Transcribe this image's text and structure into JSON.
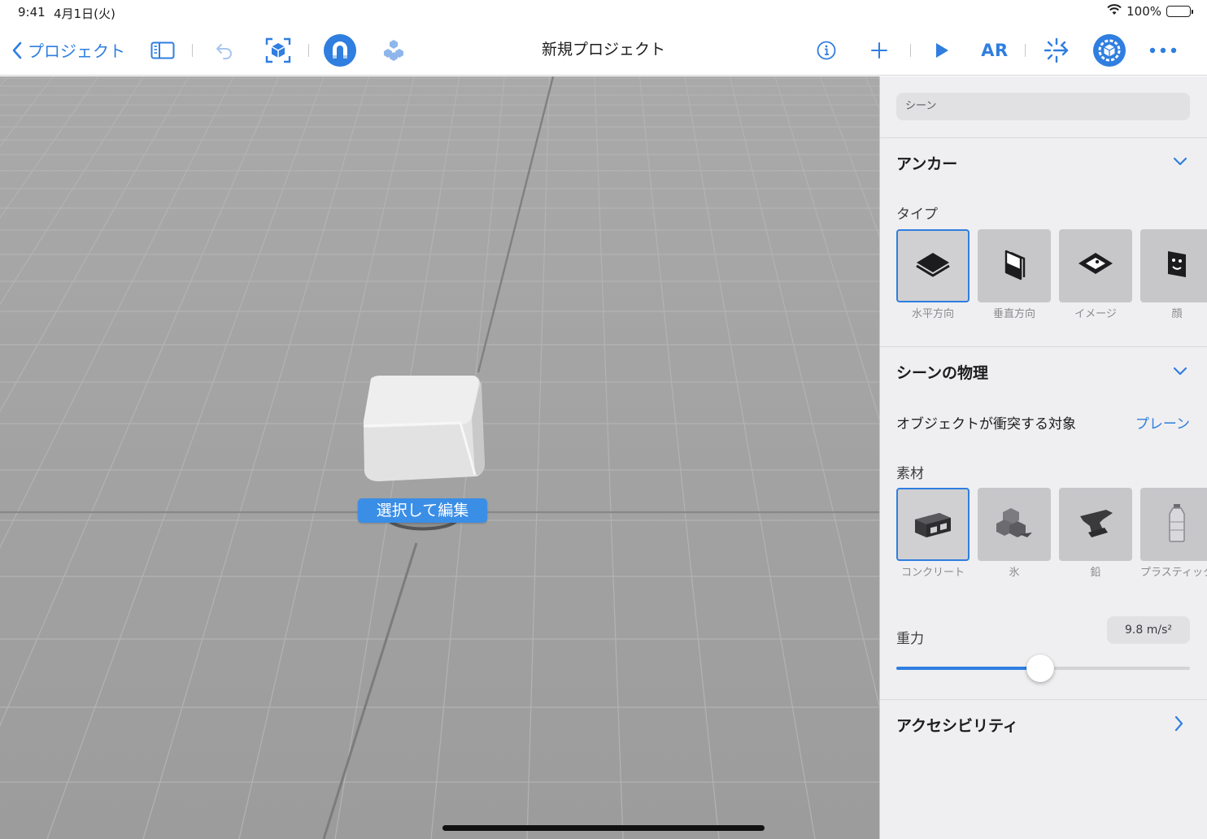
{
  "status_bar": {
    "time": "9:41",
    "date": "4月1日(火)",
    "battery_percent": "100%"
  },
  "toolbar": {
    "back_label": "プロジェクト",
    "title": "新規プロジェクト",
    "ar_label": "AR",
    "icons": [
      "chevron-left-icon",
      "sidebar-icon",
      "undo-icon",
      "cube-frame-icon",
      "magnet-icon",
      "cubes-icon",
      "info-icon",
      "plus-icon",
      "play-icon",
      "sparkle-icon",
      "settings-gear-icon",
      "more-icon"
    ],
    "accent_color": "#2f7ee0"
  },
  "viewport": {
    "select_badge": "選択して編集",
    "background": "#a2a2a2"
  },
  "inspector": {
    "scene_field": "シーン",
    "anchor": {
      "title": "アンカー",
      "type_label": "タイプ",
      "types": [
        {
          "label": "水平方向",
          "icon": "horizontal-plane-icon",
          "selected": true
        },
        {
          "label": "垂直方向",
          "icon": "vertical-plane-icon",
          "selected": false
        },
        {
          "label": "イメージ",
          "icon": "image-anchor-icon",
          "selected": false
        },
        {
          "label": "顔",
          "icon": "face-anchor-icon",
          "selected": false
        }
      ]
    },
    "physics": {
      "title": "シーンの物理",
      "collide_label": "オブジェクトが衝突する対象",
      "collide_value": "プレーン",
      "material_label": "素材",
      "materials": [
        {
          "label": "コンクリート",
          "icon": "concrete-block-icon",
          "selected": true
        },
        {
          "label": "氷",
          "icon": "ice-cubes-icon",
          "selected": false
        },
        {
          "label": "鉛",
          "icon": "anvil-icon",
          "selected": false
        },
        {
          "label": "プラスティック",
          "icon": "plastic-bottle-icon",
          "selected": false
        }
      ],
      "gravity_label": "重力",
      "gravity_value": "9.8 m/s²",
      "gravity_slider_fraction": 0.49
    },
    "accessibility": {
      "title": "アクセシビリティ"
    }
  }
}
